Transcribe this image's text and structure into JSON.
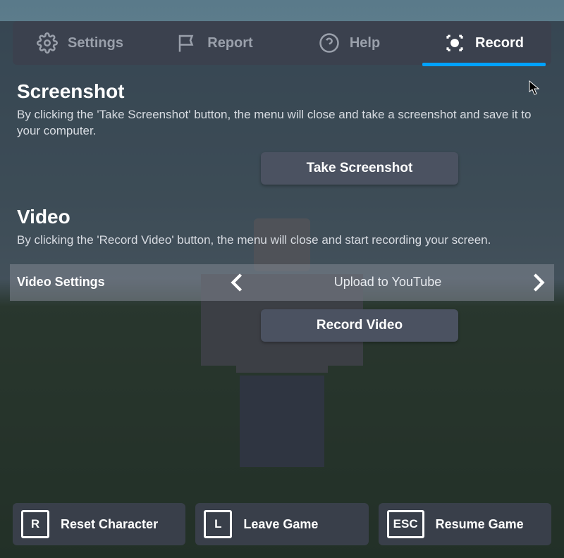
{
  "tabs": {
    "settings": "Settings",
    "report": "Report",
    "help": "Help",
    "record": "Record"
  },
  "screenshot": {
    "title": "Screenshot",
    "desc": "By clicking the 'Take Screenshot' button, the menu will close and take a screenshot and save it to your computer.",
    "button": "Take Screenshot"
  },
  "video": {
    "title": "Video",
    "desc": "By clicking the 'Record Video' button, the menu will close and start recording your screen.",
    "settings_label": "Video Settings",
    "settings_value": "Upload to YouTube",
    "button": "Record Video"
  },
  "bottom": {
    "reset": {
      "key": "R",
      "label": "Reset Character"
    },
    "leave": {
      "key": "L",
      "label": "Leave Game"
    },
    "resume": {
      "key": "ESC",
      "label": "Resume Game"
    }
  }
}
